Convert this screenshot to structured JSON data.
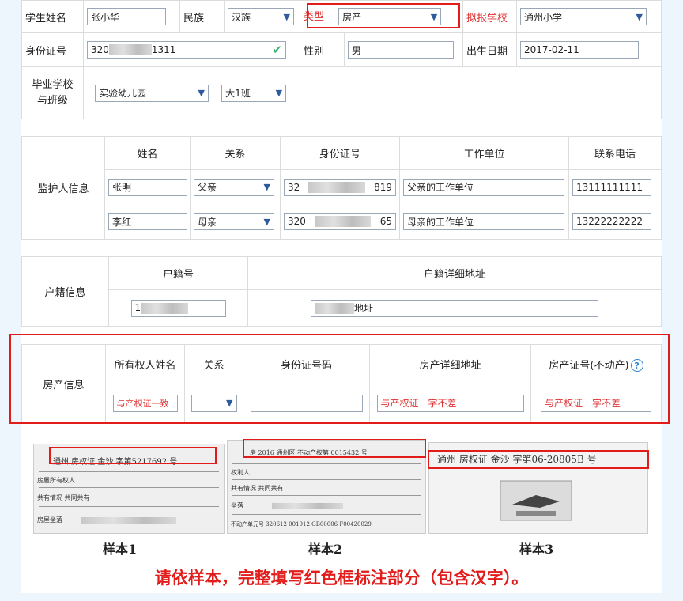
{
  "student": {
    "name_label": "学生姓名",
    "name_value": "张小华",
    "ethnicity_label": "民族",
    "ethnicity_value": "汉族",
    "type_label": "类型",
    "type_value": "房产",
    "school_label": "拟报学校",
    "school_value": "通州小学",
    "id_label": "身份证号",
    "id_prefix": "320",
    "id_suffix": "1311",
    "gender_label": "性别",
    "gender_value": "男",
    "birth_label": "出生日期",
    "birth_value": "2017-02-11",
    "grad_label_1": "毕业学校",
    "grad_label_2": "与班级",
    "kindergarten_value": "实验幼儿园",
    "class_value": "大1班"
  },
  "guardian": {
    "section_label": "监护人信息",
    "headers": [
      "姓名",
      "关系",
      "身份证号",
      "工作单位",
      "联系电话"
    ],
    "rows": [
      {
        "name": "张明",
        "relation": "父亲",
        "id_prefix": "32",
        "id_suffix": "819",
        "work": "父亲的工作单位",
        "phone": "13111111111"
      },
      {
        "name": "李红",
        "relation": "母亲",
        "id_prefix": "320",
        "id_suffix": "65",
        "work": "母亲的工作单位",
        "phone": "13222222222"
      }
    ]
  },
  "household": {
    "section_label": "户籍信息",
    "headers": [
      "户籍号",
      "户籍详细地址"
    ],
    "number_prefix": "1",
    "address_suffix": "地址"
  },
  "property": {
    "section_label": "房产信息",
    "headers": [
      "所有权人姓名",
      "关系",
      "身份证号码",
      "房产详细地址",
      "房产证号(不动产)"
    ],
    "owner_placeholder": "与产权证一致",
    "address_placeholder": "与产权证一字不差",
    "cert_placeholder": "与产权证一字不差",
    "help_glyph": "?"
  },
  "samples": {
    "items": [
      {
        "label": "样本1",
        "header": "通州  房权证  金沙  字第5217692    号",
        "rows": [
          "房屋所有权人",
          "共有情况  共同共有",
          "房屋坐落"
        ]
      },
      {
        "label": "样本2",
        "header": "房  2016  通州区  不动产权第  0015432  号",
        "rows": [
          "权利人",
          "共有情况  共同共有",
          "坐落",
          "不动产单元号  320612 001912 GB00006 F00420029"
        ]
      },
      {
        "label": "样本3",
        "header": "通州 房权证 金沙  字第06-20805B   号",
        "rows": []
      }
    ],
    "instruction": "请依样本，完整填写红色框标注部分（包含汉字）。"
  },
  "colors": {
    "accent_red": "#e21b1b",
    "label_red": "#e03131",
    "background": "#eef6fd"
  }
}
